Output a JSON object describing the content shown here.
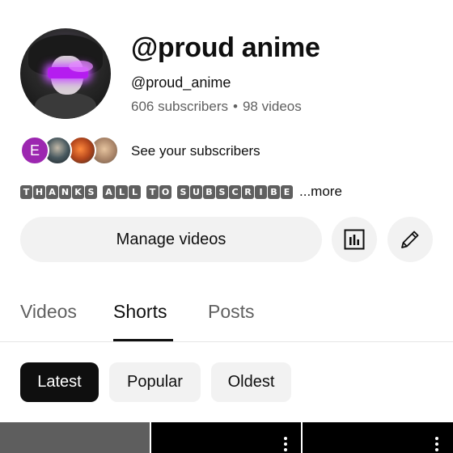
{
  "channel": {
    "name": "@proud anime",
    "handle": "@proud_anime",
    "subscribers": "606 subscribers",
    "separator": "•",
    "videos": "98 videos"
  },
  "subscribers_preview": {
    "first_initial": "E",
    "link_label": "See your subscribers"
  },
  "description": {
    "words": [
      "THANKS",
      "ALL",
      "TO",
      "SUBSCRIBE"
    ],
    "more_label": "...more"
  },
  "actions": {
    "manage_videos_label": "Manage videos",
    "analytics_icon": "analytics-icon",
    "edit_icon": "pencil-icon"
  },
  "tabs": [
    {
      "label": "Videos",
      "active": false
    },
    {
      "label": "Shorts",
      "active": true
    },
    {
      "label": "Posts",
      "active": false
    }
  ],
  "filters": [
    {
      "label": "Latest",
      "selected": true
    },
    {
      "label": "Popular",
      "selected": false
    },
    {
      "label": "Oldest",
      "selected": false
    }
  ],
  "colors": {
    "accent": "#0f0f0f",
    "chip_bg": "#f2f2f2",
    "secondary_text": "#606060",
    "avatar_initial_bg": "#9c27b0"
  }
}
